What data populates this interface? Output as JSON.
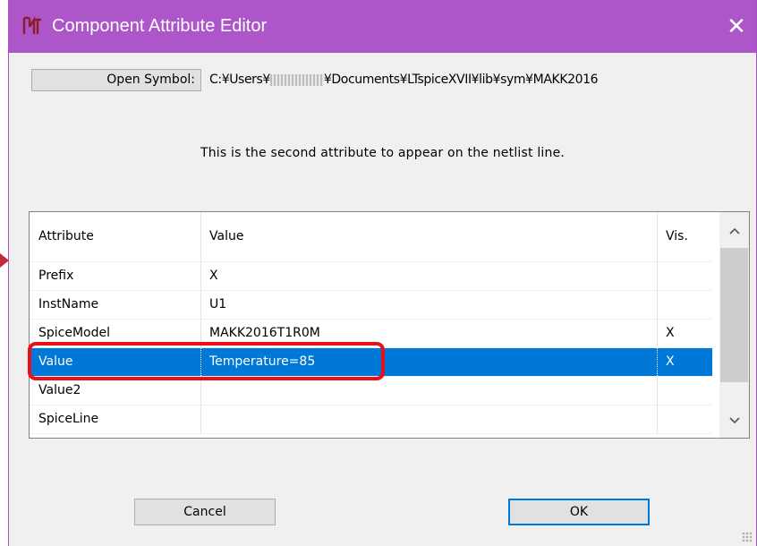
{
  "window": {
    "title": "Component Attribute Editor",
    "close_glyph": "✕"
  },
  "symbol": {
    "open_button_label": "Open Symbol:",
    "path_prefix": "C:¥Users¥",
    "path_suffix": "¥Documents¥LTspiceXVII¥lib¥sym¥MAKK2016"
  },
  "description": "This is the second attribute to appear on the netlist line.",
  "table": {
    "headers": {
      "attribute": "Attribute",
      "value": "Value",
      "vis": "Vis."
    },
    "rows": [
      {
        "attribute": "Prefix",
        "value": "X",
        "vis": ""
      },
      {
        "attribute": "InstName",
        "value": "U1",
        "vis": ""
      },
      {
        "attribute": "SpiceModel",
        "value": "MAKK2016T1R0M",
        "vis": "X"
      },
      {
        "attribute": "Value",
        "value": "Temperature=85",
        "vis": "X"
      },
      {
        "attribute": "Value2",
        "value": "",
        "vis": ""
      },
      {
        "attribute": "SpiceLine",
        "value": "",
        "vis": ""
      }
    ],
    "selected_row": 3
  },
  "buttons": {
    "cancel": "Cancel",
    "ok": "OK"
  },
  "colors": {
    "titlebar": "#ad56c9",
    "selection": "#0078d7",
    "highlight": "#e8101a"
  },
  "icons": {
    "app": "ltspice-icon",
    "close": "close-icon",
    "scroll_up": "chevron-up-icon",
    "scroll_down": "chevron-down-icon"
  }
}
